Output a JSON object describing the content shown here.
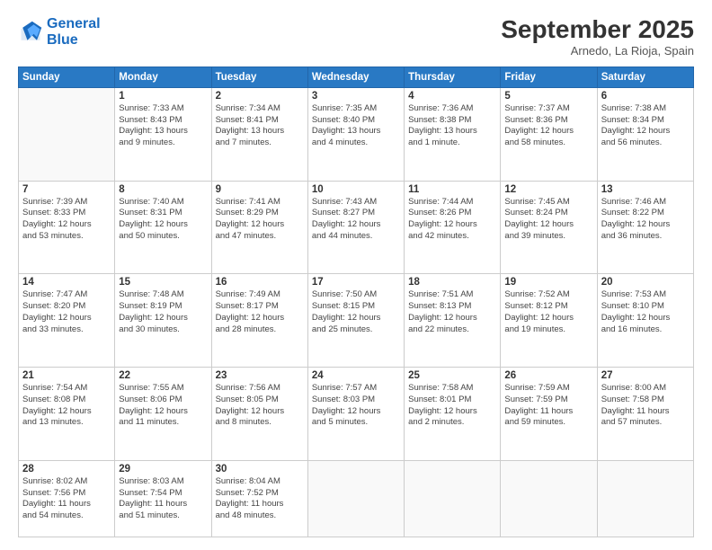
{
  "logo": {
    "line1": "General",
    "line2": "Blue"
  },
  "title": "September 2025",
  "location": "Arnedo, La Rioja, Spain",
  "weekdays": [
    "Sunday",
    "Monday",
    "Tuesday",
    "Wednesday",
    "Thursday",
    "Friday",
    "Saturday"
  ],
  "weeks": [
    [
      {
        "day": "",
        "info": ""
      },
      {
        "day": "1",
        "info": "Sunrise: 7:33 AM\nSunset: 8:43 PM\nDaylight: 13 hours\nand 9 minutes."
      },
      {
        "day": "2",
        "info": "Sunrise: 7:34 AM\nSunset: 8:41 PM\nDaylight: 13 hours\nand 7 minutes."
      },
      {
        "day": "3",
        "info": "Sunrise: 7:35 AM\nSunset: 8:40 PM\nDaylight: 13 hours\nand 4 minutes."
      },
      {
        "day": "4",
        "info": "Sunrise: 7:36 AM\nSunset: 8:38 PM\nDaylight: 13 hours\nand 1 minute."
      },
      {
        "day": "5",
        "info": "Sunrise: 7:37 AM\nSunset: 8:36 PM\nDaylight: 12 hours\nand 58 minutes."
      },
      {
        "day": "6",
        "info": "Sunrise: 7:38 AM\nSunset: 8:34 PM\nDaylight: 12 hours\nand 56 minutes."
      }
    ],
    [
      {
        "day": "7",
        "info": "Sunrise: 7:39 AM\nSunset: 8:33 PM\nDaylight: 12 hours\nand 53 minutes."
      },
      {
        "day": "8",
        "info": "Sunrise: 7:40 AM\nSunset: 8:31 PM\nDaylight: 12 hours\nand 50 minutes."
      },
      {
        "day": "9",
        "info": "Sunrise: 7:41 AM\nSunset: 8:29 PM\nDaylight: 12 hours\nand 47 minutes."
      },
      {
        "day": "10",
        "info": "Sunrise: 7:43 AM\nSunset: 8:27 PM\nDaylight: 12 hours\nand 44 minutes."
      },
      {
        "day": "11",
        "info": "Sunrise: 7:44 AM\nSunset: 8:26 PM\nDaylight: 12 hours\nand 42 minutes."
      },
      {
        "day": "12",
        "info": "Sunrise: 7:45 AM\nSunset: 8:24 PM\nDaylight: 12 hours\nand 39 minutes."
      },
      {
        "day": "13",
        "info": "Sunrise: 7:46 AM\nSunset: 8:22 PM\nDaylight: 12 hours\nand 36 minutes."
      }
    ],
    [
      {
        "day": "14",
        "info": "Sunrise: 7:47 AM\nSunset: 8:20 PM\nDaylight: 12 hours\nand 33 minutes."
      },
      {
        "day": "15",
        "info": "Sunrise: 7:48 AM\nSunset: 8:19 PM\nDaylight: 12 hours\nand 30 minutes."
      },
      {
        "day": "16",
        "info": "Sunrise: 7:49 AM\nSunset: 8:17 PM\nDaylight: 12 hours\nand 28 minutes."
      },
      {
        "day": "17",
        "info": "Sunrise: 7:50 AM\nSunset: 8:15 PM\nDaylight: 12 hours\nand 25 minutes."
      },
      {
        "day": "18",
        "info": "Sunrise: 7:51 AM\nSunset: 8:13 PM\nDaylight: 12 hours\nand 22 minutes."
      },
      {
        "day": "19",
        "info": "Sunrise: 7:52 AM\nSunset: 8:12 PM\nDaylight: 12 hours\nand 19 minutes."
      },
      {
        "day": "20",
        "info": "Sunrise: 7:53 AM\nSunset: 8:10 PM\nDaylight: 12 hours\nand 16 minutes."
      }
    ],
    [
      {
        "day": "21",
        "info": "Sunrise: 7:54 AM\nSunset: 8:08 PM\nDaylight: 12 hours\nand 13 minutes."
      },
      {
        "day": "22",
        "info": "Sunrise: 7:55 AM\nSunset: 8:06 PM\nDaylight: 12 hours\nand 11 minutes."
      },
      {
        "day": "23",
        "info": "Sunrise: 7:56 AM\nSunset: 8:05 PM\nDaylight: 12 hours\nand 8 minutes."
      },
      {
        "day": "24",
        "info": "Sunrise: 7:57 AM\nSunset: 8:03 PM\nDaylight: 12 hours\nand 5 minutes."
      },
      {
        "day": "25",
        "info": "Sunrise: 7:58 AM\nSunset: 8:01 PM\nDaylight: 12 hours\nand 2 minutes."
      },
      {
        "day": "26",
        "info": "Sunrise: 7:59 AM\nSunset: 7:59 PM\nDaylight: 11 hours\nand 59 minutes."
      },
      {
        "day": "27",
        "info": "Sunrise: 8:00 AM\nSunset: 7:58 PM\nDaylight: 11 hours\nand 57 minutes."
      }
    ],
    [
      {
        "day": "28",
        "info": "Sunrise: 8:02 AM\nSunset: 7:56 PM\nDaylight: 11 hours\nand 54 minutes."
      },
      {
        "day": "29",
        "info": "Sunrise: 8:03 AM\nSunset: 7:54 PM\nDaylight: 11 hours\nand 51 minutes."
      },
      {
        "day": "30",
        "info": "Sunrise: 8:04 AM\nSunset: 7:52 PM\nDaylight: 11 hours\nand 48 minutes."
      },
      {
        "day": "",
        "info": ""
      },
      {
        "day": "",
        "info": ""
      },
      {
        "day": "",
        "info": ""
      },
      {
        "day": "",
        "info": ""
      }
    ]
  ]
}
